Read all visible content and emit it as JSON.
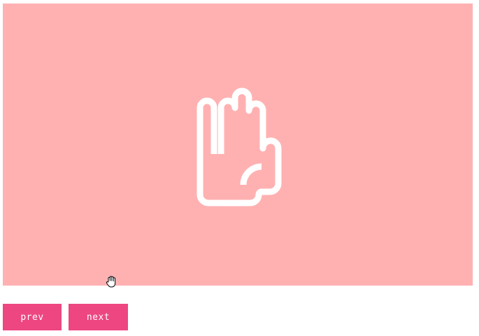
{
  "slideshow": {
    "slide": {
      "icon": "raised-hand-icon",
      "background_color": "#ffb1b2",
      "icon_color": "#ffffff"
    },
    "controls": {
      "prev_label": "prev",
      "next_label": "next",
      "button_color": "#ed4681",
      "text_color": "#ffffff"
    },
    "pointer": "grab-hand-cursor-icon"
  }
}
